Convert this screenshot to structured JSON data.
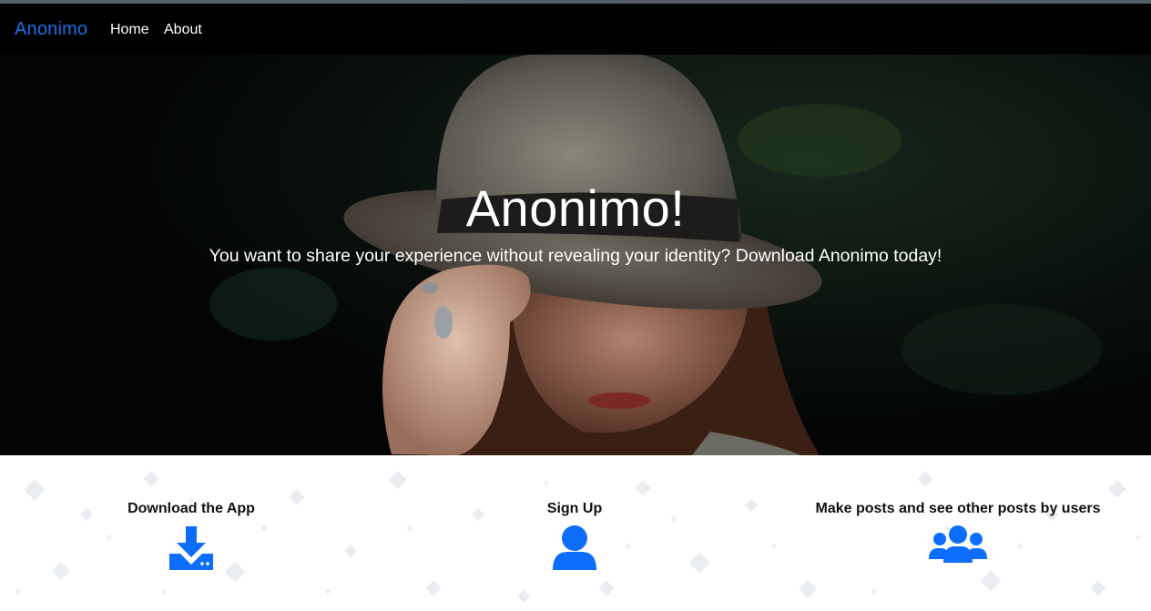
{
  "navbar": {
    "brand": "Anonimo",
    "links": [
      {
        "label": "Home"
      },
      {
        "label": "About"
      }
    ]
  },
  "hero": {
    "title": "Anonimo!",
    "subtitle": "You want to share your experience without revealing your identity? Download Anonimo today!"
  },
  "features": [
    {
      "title": "Download the App",
      "icon": "download-icon"
    },
    {
      "title": "Sign Up",
      "icon": "user-icon"
    },
    {
      "title": "Make posts and see other posts by users",
      "icon": "users-group-icon"
    }
  ],
  "colors": {
    "brand": "#1a6fe8",
    "icon": "#0d6efd",
    "navbar_bg": "#000000",
    "hero_text": "#ffffff"
  }
}
